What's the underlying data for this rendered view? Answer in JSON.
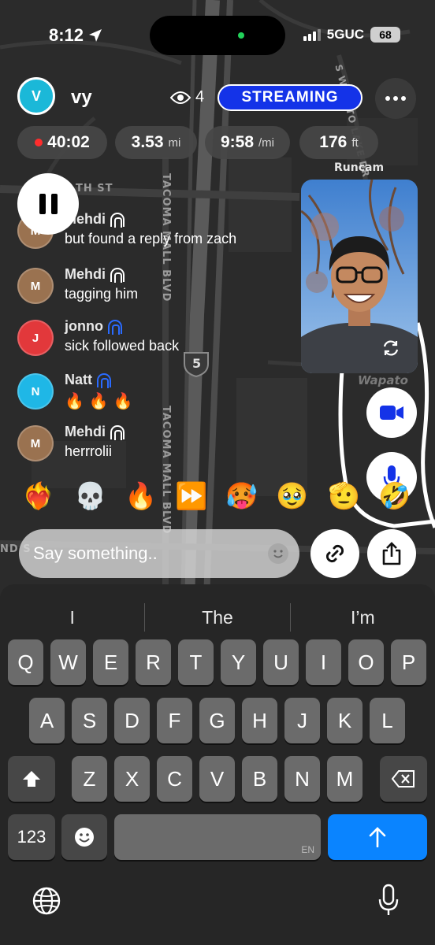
{
  "status": {
    "time": "8:12",
    "network": "5GUC",
    "battery": "68"
  },
  "map": {
    "labels": [
      "TH ST",
      "TACOMA MALL BLVD",
      "TACOMA MALL BLVD",
      "S WAPATO LAKE DR",
      "Runcam",
      "Wapato",
      "5",
      "ND S"
    ]
  },
  "header": {
    "avatar_letter": "V",
    "username": "vy",
    "viewer_count": "4",
    "streaming_label": "STREAMING"
  },
  "stats": {
    "duration": "40:02",
    "distance": "3.53",
    "distance_unit": "mi",
    "pace": "9:58",
    "pace_unit": "/mi",
    "elevation": "176",
    "elevation_unit": "ft"
  },
  "chat": [
    {
      "letter": "M",
      "name": "Mehdi",
      "text": "but found a reply from zach",
      "color": "#9a7250",
      "badge": "white"
    },
    {
      "letter": "M",
      "name": "Mehdi",
      "text": "tagging him",
      "color": "#9a7250",
      "badge": "white"
    },
    {
      "letter": "J",
      "name": "jonno",
      "text": "sick followed back",
      "color": "#e2383b",
      "badge": "blue"
    },
    {
      "letter": "N",
      "name": "Natt",
      "text": "🔥🔥🔥",
      "color": "#1fb7e6",
      "badge": "blue"
    },
    {
      "letter": "M",
      "name": "Mehdi",
      "text": "herrrolii",
      "color": "#9a7250",
      "badge": "white"
    }
  ],
  "reactions": [
    "❤️‍🔥",
    "💀",
    "🔥",
    "⏩",
    "🥵",
    "🥹",
    "🫡",
    "🤣"
  ],
  "input": {
    "placeholder": "Say something.."
  },
  "keyboard": {
    "suggestions": [
      "I",
      "The",
      "I’m"
    ],
    "row1": [
      "Q",
      "W",
      "E",
      "R",
      "T",
      "Y",
      "U",
      "I",
      "O",
      "P"
    ],
    "row2": [
      "A",
      "S",
      "D",
      "F",
      "G",
      "H",
      "J",
      "K",
      "L"
    ],
    "row3": [
      "Z",
      "X",
      "C",
      "V",
      "B",
      "N",
      "M"
    ],
    "numbers_label": "123",
    "space_lang": "EN"
  },
  "colors": {
    "streaming_blue": "#1433e8",
    "record_red": "#ff2d2d",
    "send_blue": "#0a84ff"
  }
}
